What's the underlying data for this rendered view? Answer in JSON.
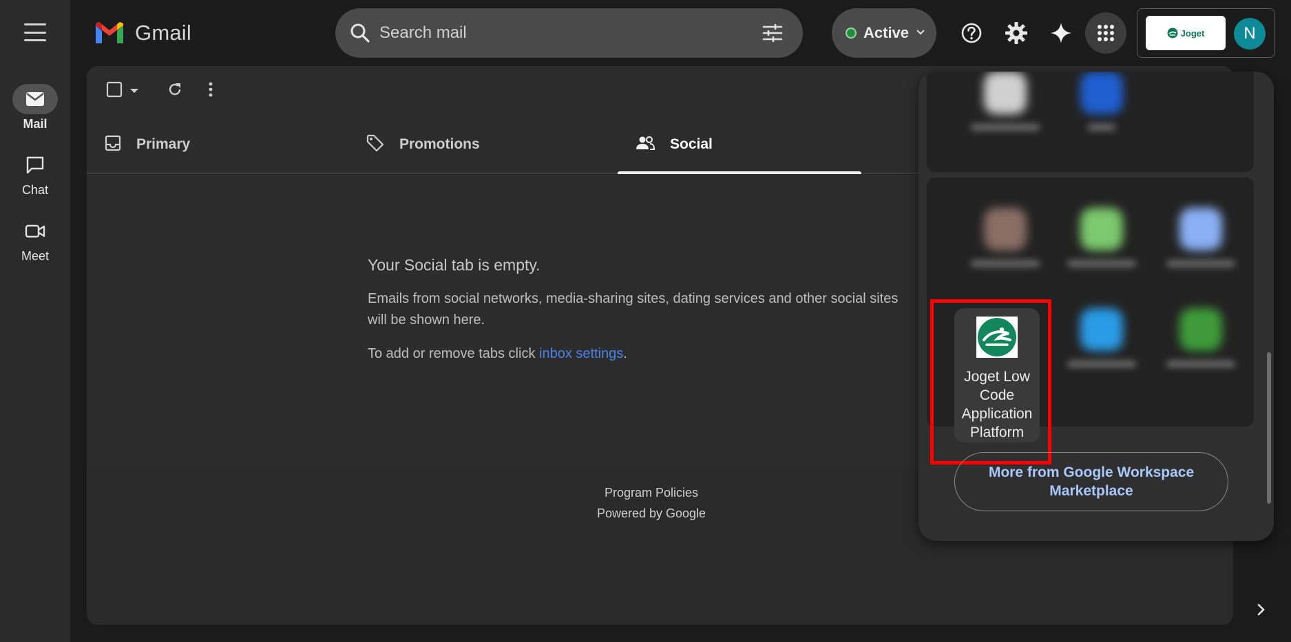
{
  "sidebar": {
    "items": [
      {
        "label": "Mail"
      },
      {
        "label": "Chat"
      },
      {
        "label": "Meet"
      }
    ]
  },
  "header": {
    "app_name": "Gmail",
    "search_placeholder": "Search mail",
    "status_label": "Active",
    "account_badge": "Joget",
    "avatar_initial": "N"
  },
  "tabs": [
    {
      "label": "Primary"
    },
    {
      "label": "Promotions"
    },
    {
      "label": "Social"
    }
  ],
  "empty_state": {
    "title": "Your Social tab is empty.",
    "description_line1": "Emails from social networks, media-sharing sites, dating services and other social sites",
    "description_line2": "will be shown here.",
    "tabs_prefix": "To add or remove tabs click ",
    "tabs_link": "inbox settings",
    "tabs_suffix": "."
  },
  "footer": {
    "program_policies": "Program Policies",
    "powered_by": "Powered by Google"
  },
  "apps_panel": {
    "highlighted_app": "Joget Low Code Application Platform",
    "more_button": "More from Google Workspace Marketplace"
  },
  "colors": {
    "accent_link": "#4a82e8",
    "status_green": "#1e8e3e",
    "highlight_red": "#ff0000",
    "avatar_teal": "#0e8a96"
  }
}
